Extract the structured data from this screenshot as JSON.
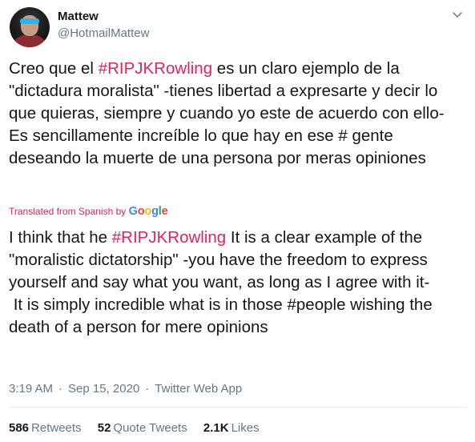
{
  "tweet": {
    "author": {
      "name": "Mattew",
      "handle": "@HotmailMattew"
    },
    "original": {
      "part1": "Creo que el ",
      "hashtag": "#RIPJKRowling",
      "part2": " es un claro ejemplo de la \"dictadura moralista\" -tienes libertad a expresarte y decir lo que quieras, siempre y cuando yo este de acuerdo con ello-\nEs sencillamente increíble lo que hay en ese # gente deseando la muerte de una persona por meras opiniones"
    },
    "translation": {
      "label": "Translated from Spanish by ",
      "provider": "Google",
      "provider_letters": [
        "G",
        "o",
        "o",
        "g",
        "l",
        "e"
      ],
      "part1": "I think that he ",
      "hashtag": "#RIPJKRowling",
      "part2": " It is a clear example of the \"moralistic dictatorship\" -you have the freedom to express yourself and say what you want, as long as I agree with it-\n It is simply incredible what is in those #people wishing the death of a person for mere opinions"
    },
    "meta": {
      "time": "3:19 AM",
      "date": "Sep 15, 2020",
      "source": "Twitter Web App",
      "separator": "·"
    },
    "stats": {
      "retweets_count": "586",
      "retweets_label": "Retweets",
      "quotes_count": "52",
      "quotes_label": "Quote Tweets",
      "likes_count": "2.1K",
      "likes_label": "Likes"
    }
  },
  "icons": {
    "avatar": "user-avatar-photo",
    "more": "chevron-down-icon"
  },
  "colors": {
    "hashtag": "#e0245e",
    "secondary_text": "#657786",
    "primary_text": "#14171a",
    "divider": "#e6ecf0"
  }
}
